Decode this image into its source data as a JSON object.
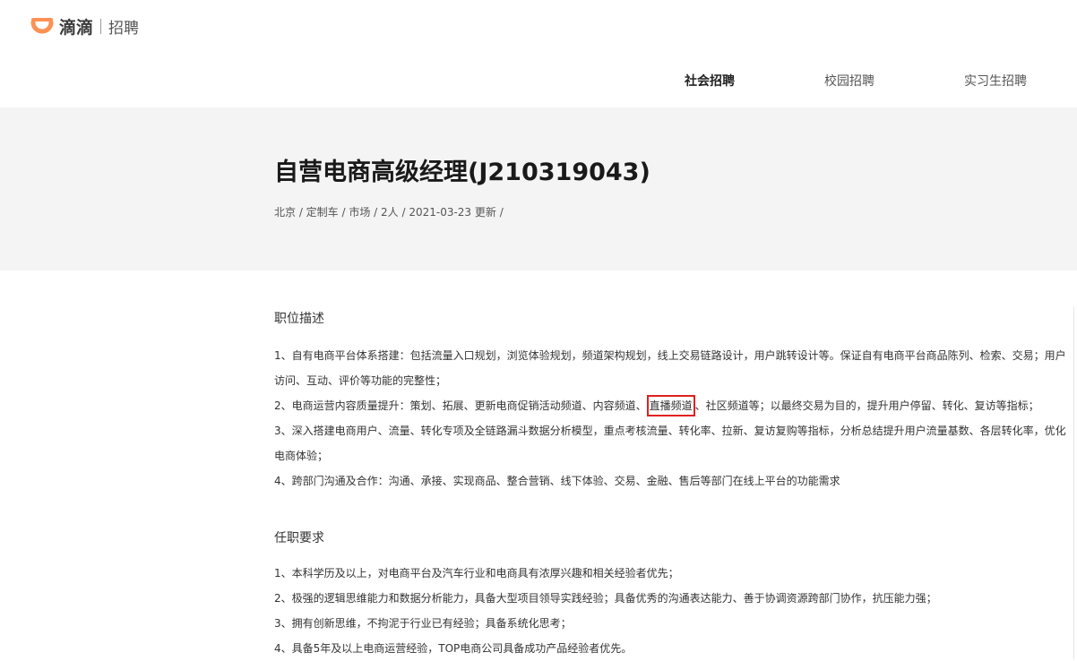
{
  "header": {
    "brand": "滴滴",
    "sub": "招聘",
    "logo_icon": "didi-logo-icon",
    "brand_color": "#fc9153"
  },
  "nav": {
    "items": [
      {
        "label": "社会招聘",
        "active": true
      },
      {
        "label": "校园招聘",
        "active": false
      },
      {
        "label": "实习生招聘",
        "active": false
      }
    ]
  },
  "job": {
    "title": "自营电商高级经理(J210319043)",
    "meta": "北京 / 定制车 / 市场 / 2人 / 2021-03-23 更新 /"
  },
  "description": {
    "title": "职位描述",
    "p1": "1、自有电商平台体系搭建：包括流量入口规划，浏览体验规划，频道架构规划，线上交易链路设计，用户跳转设计等。保证自有电商平台商品陈列、检索、交易；用户访问、互动、评价等功能的完整性；",
    "p2_before": "2、电商运营内容质量提升：策划、拓展、更新电商促销活动频道、内容频道、",
    "p2_highlight": "直播频道",
    "p2_after": "、社区频道等；以最终交易为目的，提升用户停留、转化、复访等指标；",
    "p3": "3、深入搭建电商用户、流量、转化专项及全链路漏斗数据分析模型，重点考核流量、转化率、拉新、复访复购等指标，分析总结提升用户流量基数、各层转化率，优化电商体验；",
    "p4": "4、跨部门沟通及合作：沟通、承接、实现商品、整合营销、线下体验、交易、金融、售后等部门在线上平台的功能需求"
  },
  "requirements": {
    "title": "任职要求",
    "items": [
      "1、本科学历及以上，对电商平台及汽车行业和电商具有浓厚兴趣和相关经验者优先；",
      "2、极强的逻辑思维能力和数据分析能力，具备大型项目领导实践经验；具备优秀的沟通表达能力、善于协调资源跨部门协作，抗压能力强；",
      "3、拥有创新思维，不拘泥于行业已有经验；具备系统化思考；",
      "4、具备5年及以上电商运营经验，TOP电商公司具备成功产品经验者优先。"
    ]
  },
  "colors": {
    "highlight_border": "#e02020",
    "hero_background": "#f4f4f4"
  }
}
